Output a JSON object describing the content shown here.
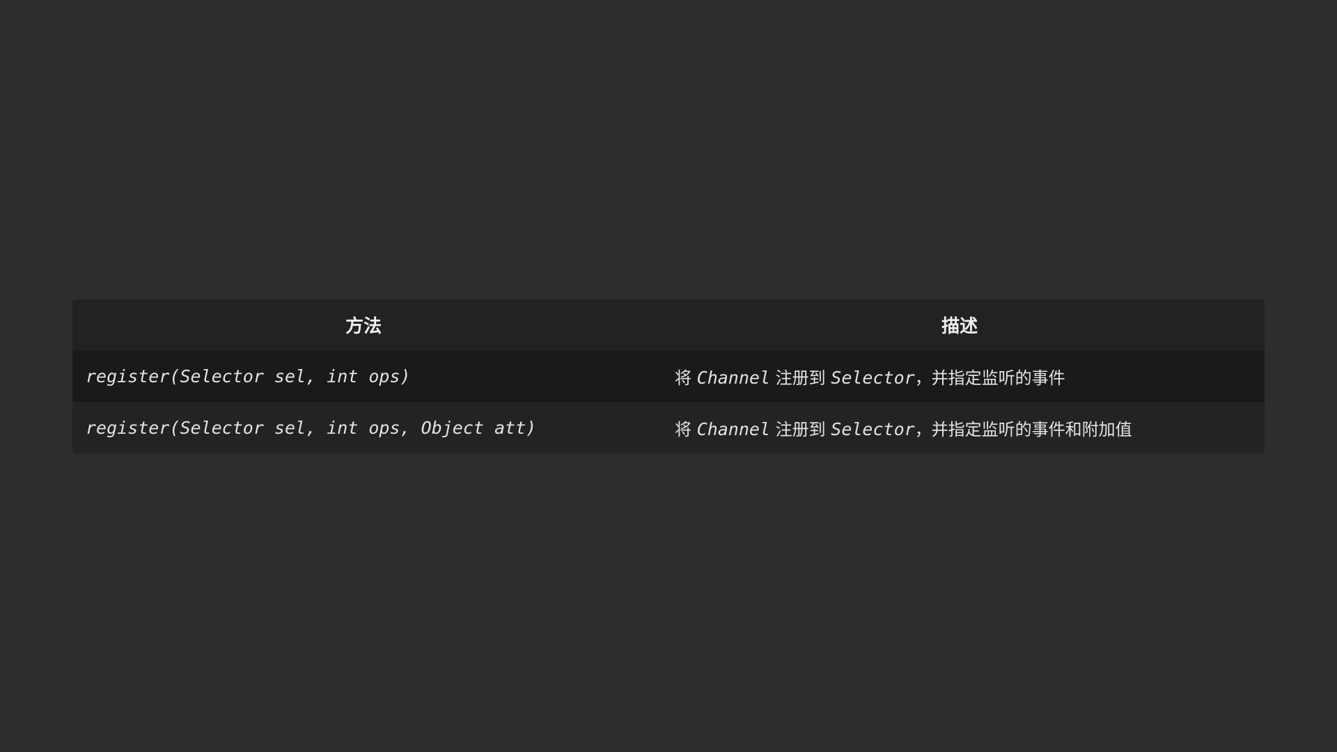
{
  "table": {
    "headers": [
      "方法",
      "描述"
    ],
    "rows": [
      {
        "method": "register(Selector sel, int ops)",
        "desc": {
          "p1": "将 ",
          "c1": "Channel",
          "p2": " 注册到 ",
          "c2": "Selector",
          "p3": "，并指定监听的事件"
        }
      },
      {
        "method": "register(Selector sel, int ops, Object att)",
        "desc": {
          "p1": "将 ",
          "c1": "Channel",
          "p2": " 注册到 ",
          "c2": "Selector",
          "p3": "，并指定监听的事件和附加值"
        }
      }
    ]
  },
  "colors": {
    "background": "#2d2d2d",
    "header_row": "#222222",
    "row_dark": "#1a1a1a",
    "row_light": "#232323",
    "text": "#e3e3e3"
  }
}
